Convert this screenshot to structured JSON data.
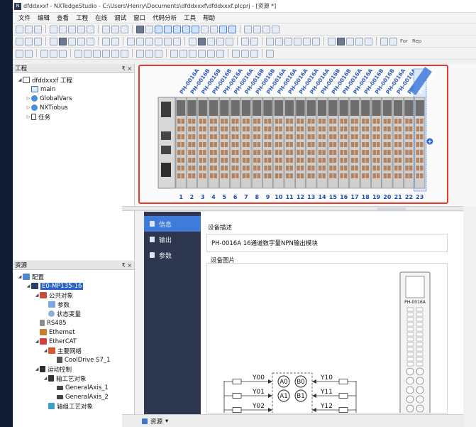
{
  "window": {
    "title": "dfddxxxf - NXTedgeStudio - C:\\Users\\Henry\\Documents\\dfddxxxf\\dfddxxxf.plcprj - [资源 *]"
  },
  "menu": [
    "文件",
    "编辑",
    "查看",
    "工程",
    "在线",
    "调试",
    "窗口",
    "代码分析",
    "工具",
    "帮助"
  ],
  "toolbar": {
    "labels": [
      "For",
      "Rep"
    ]
  },
  "project_panel": {
    "title": "工程",
    "pin": "₹ ×",
    "items": [
      {
        "label": "dfddxxxf 工程",
        "level": 0,
        "exp": "◢",
        "icon": "proj"
      },
      {
        "label": "main",
        "level": 1,
        "exp": "",
        "icon": "prog"
      },
      {
        "label": "GlobalVars",
        "level": 1,
        "exp": "▷",
        "icon": "glob"
      },
      {
        "label": "NXTiobus",
        "level": 1,
        "exp": "▷",
        "icon": "glob"
      },
      {
        "label": "任务",
        "level": 1,
        "exp": "▷",
        "icon": "task"
      }
    ]
  },
  "resource_panel": {
    "title": "资源",
    "pin": "₹ ×",
    "items": [
      {
        "label": "配置",
        "level": 0,
        "exp": "◢",
        "icon": "cfg"
      },
      {
        "label": "E0-MP135-16",
        "level": 1,
        "exp": "◢",
        "icon": "dev",
        "selected": true
      },
      {
        "label": "公共对象",
        "level": 2,
        "exp": "◢",
        "icon": "folder"
      },
      {
        "label": "参数",
        "level": 3,
        "exp": "",
        "icon": "param"
      },
      {
        "label": "状态变量",
        "level": 3,
        "exp": "",
        "icon": "state"
      },
      {
        "label": "RS485",
        "level": 2,
        "exp": "",
        "icon": "rs"
      },
      {
        "label": "Ethernet",
        "level": 2,
        "exp": "",
        "icon": "eth"
      },
      {
        "label": "EtherCAT",
        "level": 2,
        "exp": "◢",
        "icon": "ecat"
      },
      {
        "label": "主要网络",
        "level": 3,
        "exp": "◢",
        "icon": "net"
      },
      {
        "label": "CoolDrive S7_1",
        "level": 4,
        "exp": "",
        "icon": "drive"
      },
      {
        "label": "运动控制",
        "level": 2,
        "exp": "◢",
        "icon": "motion"
      },
      {
        "label": "轴工艺对象",
        "level": 3,
        "exp": "◢",
        "icon": "axisg"
      },
      {
        "label": "GeneralAxis_1",
        "level": 4,
        "exp": "",
        "icon": "axis"
      },
      {
        "label": "GeneralAxis_2",
        "level": 4,
        "exp": "",
        "icon": "axis"
      },
      {
        "label": "轴组工艺对象",
        "level": 3,
        "exp": "",
        "icon": "axisobj"
      }
    ]
  },
  "hardware": {
    "modules": [
      "PH-0016A",
      "PH-0016B",
      "PH-0016B",
      "PH-0016B",
      "PH-0016A",
      "PH-0016A",
      "PH-0016B",
      "PH-0016B",
      "PH-0016A",
      "PH-0016A",
      "PH-0016A",
      "PH-0016A",
      "PH-0016A",
      "PH-0016B",
      "PH-0016B",
      "PH-0016A",
      "PH-0016A",
      "PH-0016B",
      "PH-0016B",
      "PH-0016A",
      "PH-0016A",
      "PH-0016B",
      "PH-0016A"
    ],
    "slots": [
      "1",
      "2",
      "3",
      "4",
      "5",
      "6",
      "7",
      "8",
      "9",
      "10",
      "11",
      "12",
      "13",
      "14",
      "15",
      "16",
      "17",
      "18",
      "19",
      "20",
      "21",
      "22",
      "23"
    ],
    "selected_slot": 23,
    "add_icon": "+"
  },
  "props_nav": [
    {
      "label": "信息",
      "active": true
    },
    {
      "label": "输出",
      "active": false
    },
    {
      "label": "参数",
      "active": false
    }
  ],
  "device": {
    "desc_title": "设备描述",
    "description": "PH-0016A 16通道数字量NPN输出模块",
    "image_title": "设备图片",
    "image_label": "PH-0016A",
    "io_left": [
      "Y00",
      "Y01",
      "Y02"
    ],
    "io_right": [
      "Y10",
      "Y11",
      "Y12"
    ],
    "io_a": [
      "A0",
      "A1"
    ],
    "io_b": [
      "B0",
      "B1"
    ]
  },
  "status": {
    "tab": "资源"
  }
}
